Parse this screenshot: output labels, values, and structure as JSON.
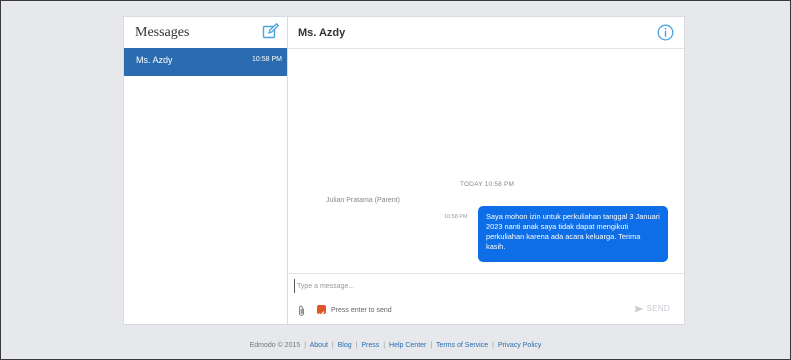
{
  "sidebar": {
    "title": "Messages",
    "threads": [
      {
        "name": "Ms. Azdy",
        "time": "10:58 PM"
      }
    ]
  },
  "conversation": {
    "title": "Ms. Azdy",
    "day_label": "TODAY 10:58 PM",
    "sender": "Julian Pratama (Parent)",
    "message": {
      "time": "10:58 PM",
      "text": "Saya mohon izin untuk perkuliahan tanggal 3 Januari 2023 nanti anak saya tidak dapat mengikuti perkuliahan karena ada acara keluarga. Terima kasih."
    }
  },
  "composer": {
    "placeholder": "Type a message...",
    "value": "",
    "enter_to_send_label": "Press enter to send",
    "enter_to_send_checked": true,
    "send_label": "SEND"
  },
  "footer": {
    "copyright": "Edmodo © 2015",
    "links": [
      "About",
      "Blog",
      "Press",
      "Help Center",
      "Terms of Service",
      "Privacy Policy"
    ]
  },
  "colors": {
    "accent": "#2b6cb0",
    "bubble": "#0d6ee8",
    "checkbox": "#e0562a",
    "icon": "#4aa3df"
  },
  "icons": {
    "compose": "compose-icon",
    "info": "info-icon",
    "attach": "paperclip-icon",
    "send": "send-arrow-icon"
  }
}
